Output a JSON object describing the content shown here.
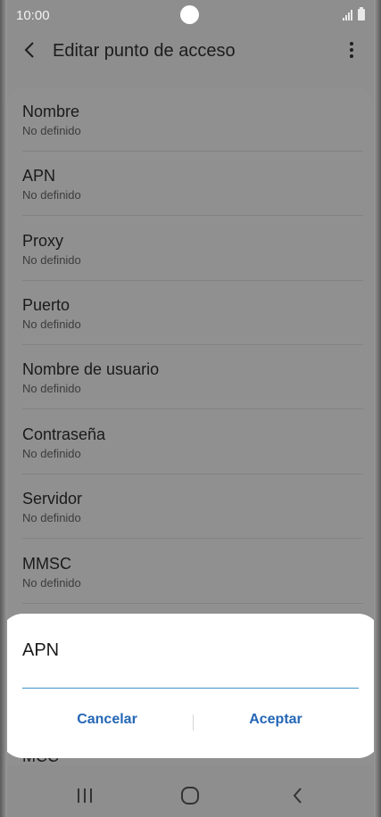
{
  "status_bar": {
    "time": "10:00"
  },
  "header": {
    "title": "Editar punto de acceso"
  },
  "rows": [
    {
      "title": "Nombre",
      "value": "No definido"
    },
    {
      "title": "APN",
      "value": "No definido"
    },
    {
      "title": "Proxy",
      "value": "No definido"
    },
    {
      "title": "Puerto",
      "value": "No definido"
    },
    {
      "title": "Nombre de usuario",
      "value": "No definido"
    },
    {
      "title": "Contraseña",
      "value": "No definido"
    },
    {
      "title": "Servidor",
      "value": "No definido"
    },
    {
      "title": "MMSC",
      "value": "No definido"
    }
  ],
  "partial_row": "MCC",
  "dialog": {
    "title": "APN",
    "input_value": "",
    "cancel_label": "Cancelar",
    "accept_label": "Aceptar"
  },
  "colors": {
    "accent": "#2466b5",
    "input_underline": "#3a93c8",
    "dim_background": "#8e8e8e"
  }
}
